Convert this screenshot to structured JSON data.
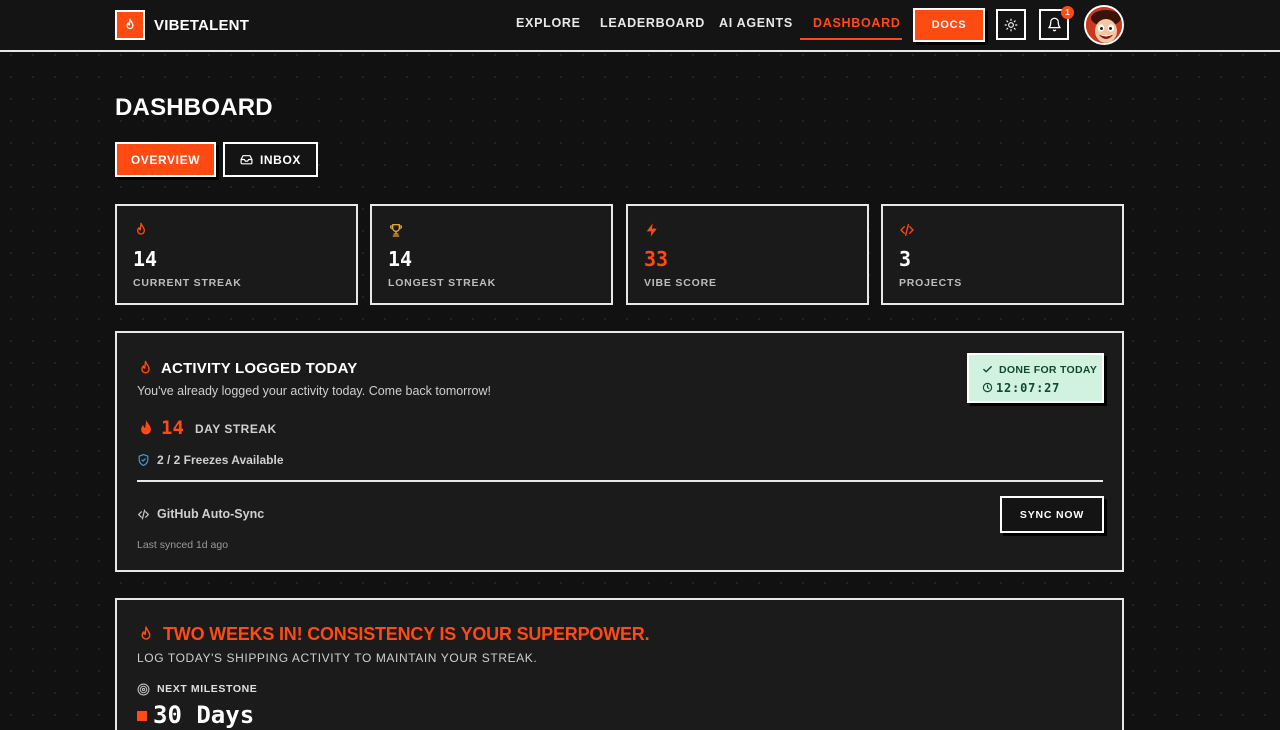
{
  "brand": {
    "name": "VIBETALENT",
    "accent": "#ff4a12"
  },
  "nav": {
    "items": [
      {
        "label": "EXPLORE"
      },
      {
        "label": "LEADERBOARD"
      },
      {
        "label": "AI AGENTS"
      },
      {
        "label": "DASHBOARD",
        "active": true
      }
    ],
    "docs_label": "DOCS",
    "notification_count": "1",
    "theme_icon": "sun-icon",
    "bell_icon": "bell-icon"
  },
  "page": {
    "title": "DASHBOARD",
    "tabs": [
      {
        "label": "OVERVIEW",
        "active": true
      },
      {
        "label": "INBOX",
        "icon": "inbox-icon"
      }
    ]
  },
  "stats": [
    {
      "icon": "flame-icon",
      "value": "14",
      "label": "CURRENT STREAK"
    },
    {
      "icon": "trophy-icon",
      "value": "14",
      "label": "LONGEST STREAK"
    },
    {
      "icon": "bolt-icon",
      "value": "33",
      "label": "VIBE SCORE",
      "highlight": true
    },
    {
      "icon": "code-icon",
      "value": "3",
      "label": "PROJECTS"
    }
  ],
  "activity": {
    "title": "ACTIVITY LOGGED TODAY",
    "description": "You've already logged your activity today. Come back tomorrow!",
    "streak_value": "14",
    "streak_label": "DAY STREAK",
    "freezes": "2 / 2 Freezes Available",
    "done_label": "DONE FOR TODAY",
    "timer": "12:07:27",
    "done_bg": "#d1f2df",
    "github_label": "GitHub Auto-Sync",
    "last_synced": "Last synced 1d ago",
    "sync_button": "SYNC NOW"
  },
  "motivation": {
    "title": "TWO WEEKS IN! CONSISTENCY IS YOUR SUPERPOWER.",
    "subtitle": "LOG TODAY'S SHIPPING ACTIVITY TO MAINTAIN YOUR STREAK.",
    "milestone_label": "NEXT MILESTONE",
    "milestone_value": "30 Days"
  }
}
